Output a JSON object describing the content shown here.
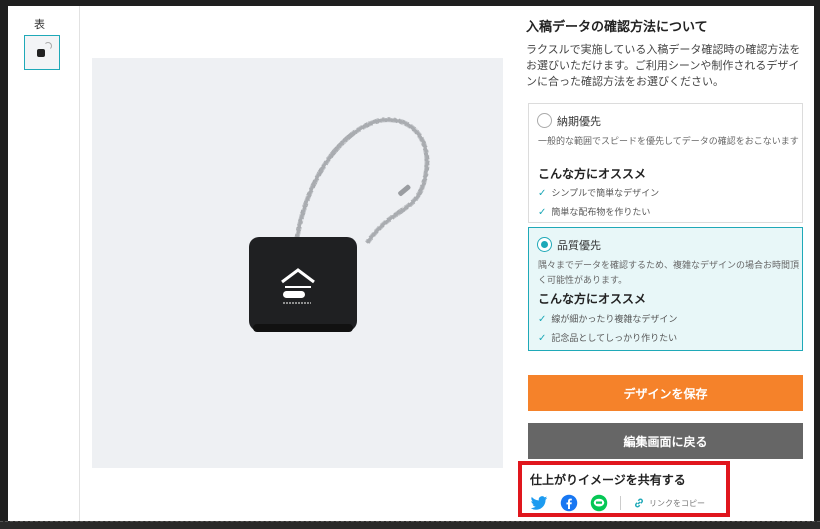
{
  "thumbnail": {
    "label": "表"
  },
  "panel": {
    "title": "入稿データの確認方法について",
    "description": "ラクスルで実施している入稿データ確認時の確認方法をお選びいただけます。ご利用シーンや制作されるデザインに合った確認方法をお選びください。"
  },
  "options": [
    {
      "name": "納期優先",
      "selected": false,
      "description": "一般的な範囲でスピードを優先してデータの確認をおこないます",
      "recommend_heading": "こんな方にオススメ",
      "recommend_items": [
        "シンプルで簡単なデザイン",
        "簡単な配布物を作りたい"
      ]
    },
    {
      "name": "品質優先",
      "selected": true,
      "description": "隅々までデータを確認するため、複雑なデザインの場合お時間頂く可能性があります。",
      "recommend_heading": "こんな方にオススメ",
      "recommend_items": [
        "線が細かったり複雑なデザイン",
        "記念品としてしっかり作りたい"
      ]
    }
  ],
  "buttons": {
    "save_label": "デザインを保存",
    "back_label": "編集画面に戻る"
  },
  "share": {
    "title": "仕上がりイメージを共有する",
    "icons": [
      "twitter-icon",
      "facebook-icon",
      "line-icon"
    ],
    "copy_link_label": "リンクをコピー"
  },
  "colors": {
    "accent": "#1fa9b8",
    "save_button": "#f5822a",
    "back_button": "#666666",
    "highlight_border": "#e0161d",
    "twitter": "#1d9bf0",
    "facebook": "#1877f2",
    "line": "#06c755"
  }
}
